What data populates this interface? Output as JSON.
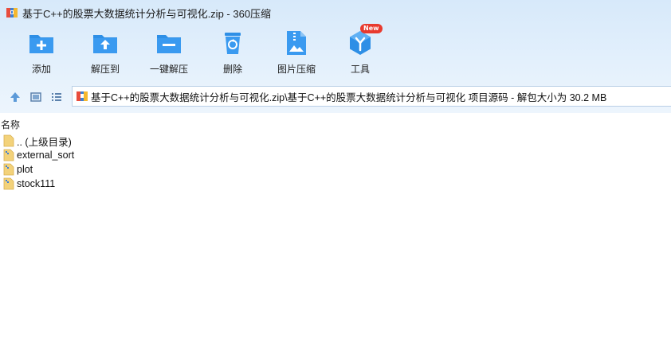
{
  "window": {
    "title": "基于C++的股票大数据统计分析与可视化.zip - 360压缩"
  },
  "toolbar": {
    "items": [
      {
        "label": "添加",
        "icon": "folder-add-icon"
      },
      {
        "label": "解压到",
        "icon": "folder-extract-icon"
      },
      {
        "label": "一键解压",
        "icon": "folder-oneclick-extract-icon"
      },
      {
        "label": "删除",
        "icon": "recycle-bin-icon"
      },
      {
        "label": "图片压缩",
        "icon": "image-compress-icon"
      },
      {
        "label": "工具",
        "icon": "tools-cube-icon",
        "badge": "New"
      }
    ]
  },
  "address": {
    "path": "基于C++的股票大数据统计分析与可视化.zip\\基于C++的股票大数据统计分析与可视化 项目源码 - 解包大小为 30.2 MB"
  },
  "file_list": {
    "column_name": "名称",
    "rows": [
      {
        "name": ".. (上级目录)",
        "type": "parent-folder"
      },
      {
        "name": "external_sort",
        "type": "folder"
      },
      {
        "name": "plot",
        "type": "folder"
      },
      {
        "name": "stock111",
        "type": "folder"
      }
    ]
  },
  "colors": {
    "accent_blue": "#2e8fe6",
    "badge_red": "#e83a2e",
    "folder_yellow": "#f3d27a"
  }
}
